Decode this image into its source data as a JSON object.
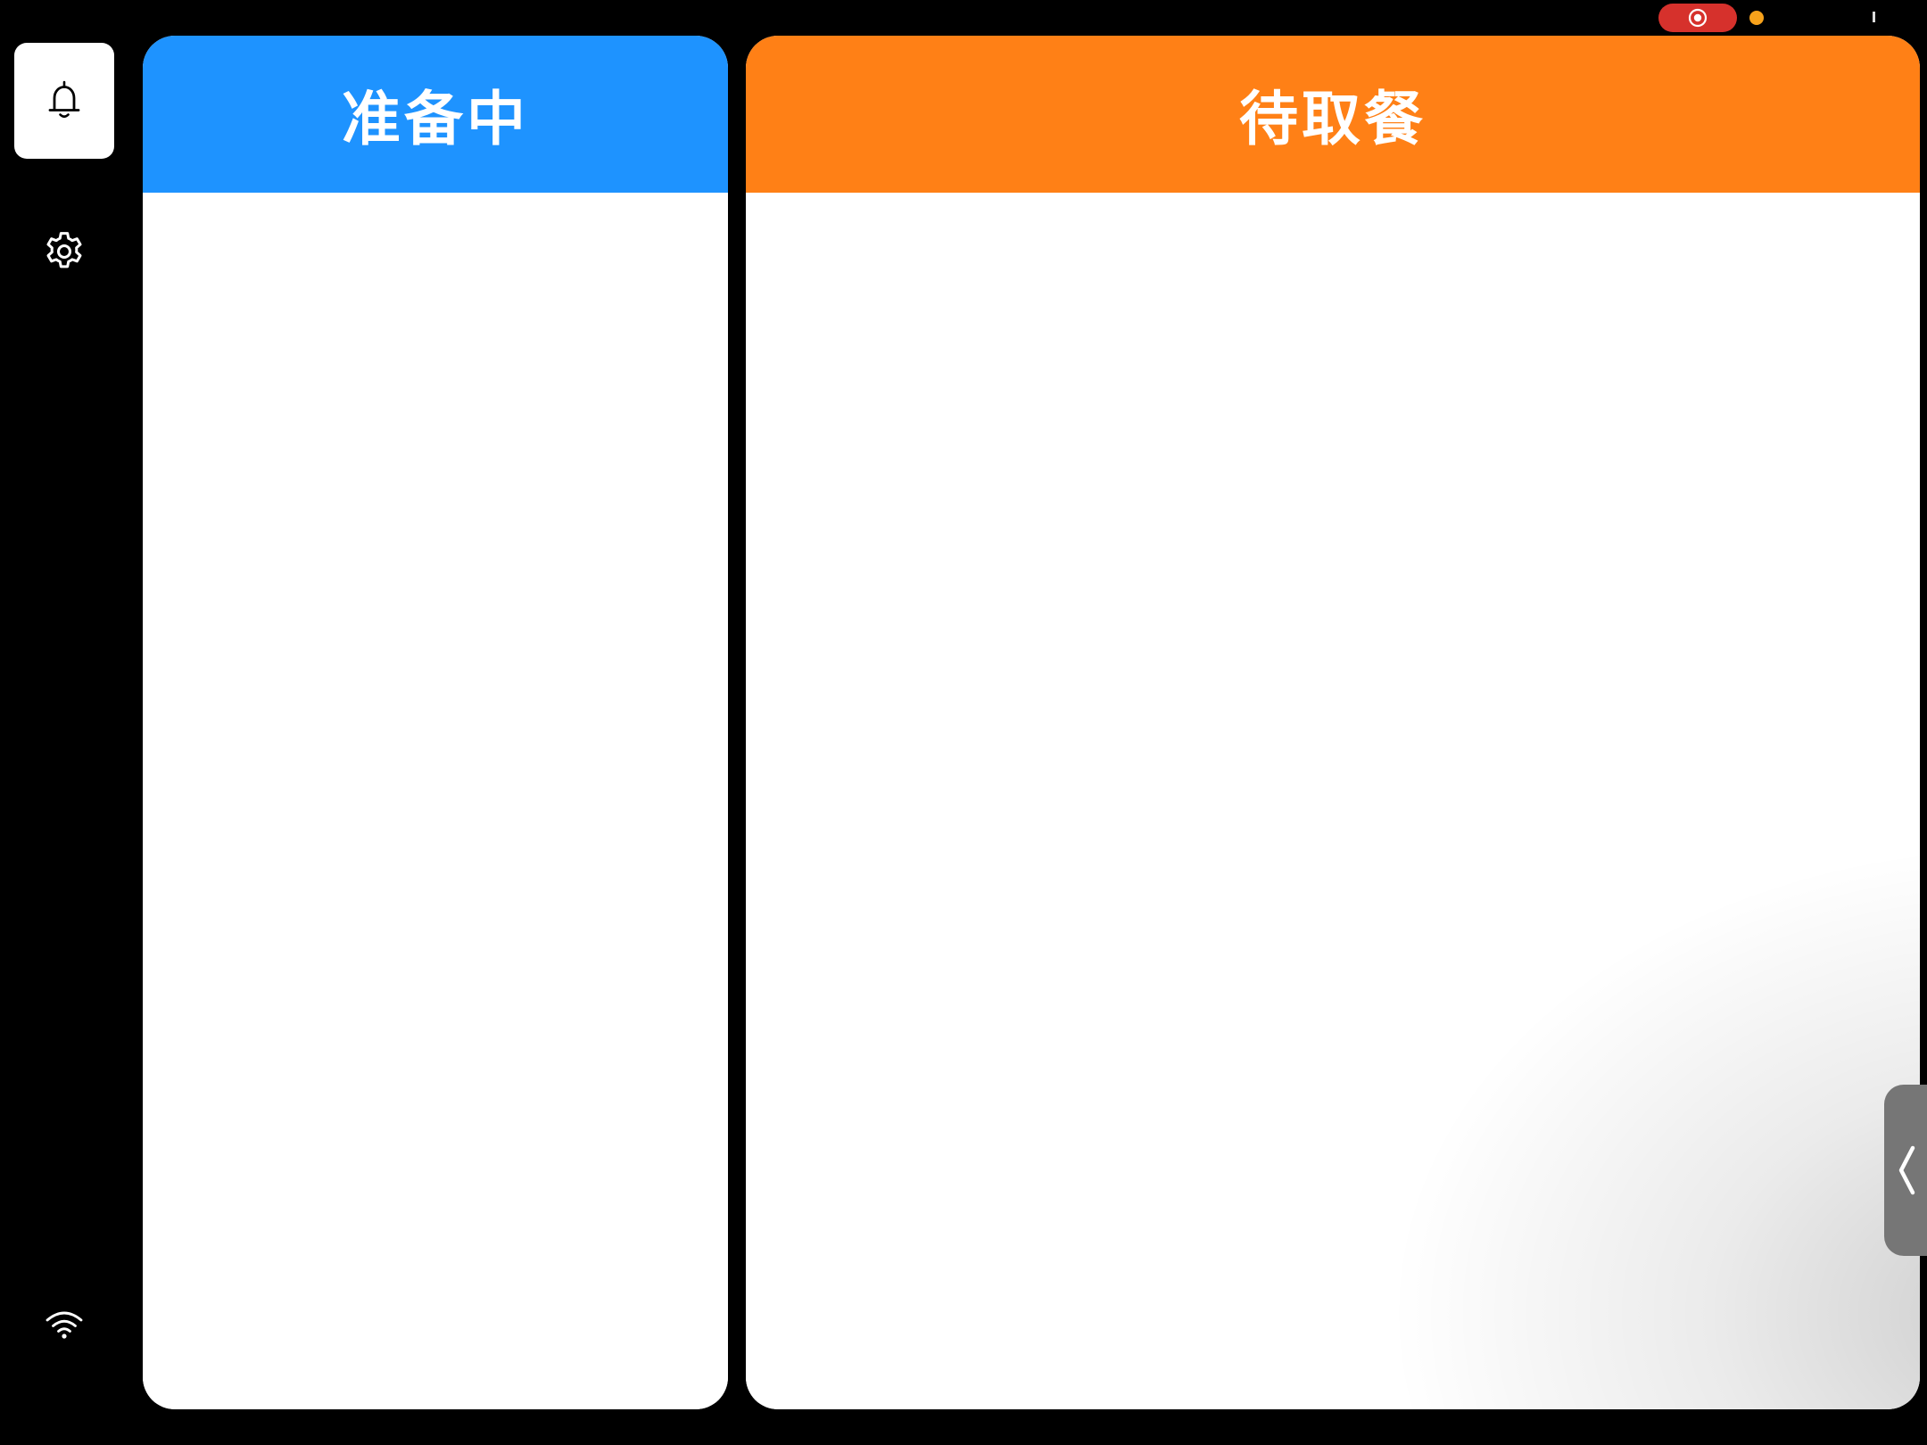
{
  "colors": {
    "preparing_header": "#1E93FF",
    "pickup_header": "#FF8016",
    "record_pill": "#D6312C",
    "status_dot": "#F7A21B",
    "drawer_handle": "#767676"
  },
  "status_bar": {
    "record_icon": "record-indicator-icon"
  },
  "sidebar": {
    "items": [
      {
        "id": "notifications",
        "icon": "bell-icon",
        "active": true
      },
      {
        "id": "settings",
        "icon": "gear-icon",
        "active": false
      }
    ],
    "connection_icon": "wifi-icon"
  },
  "panels": {
    "preparing": {
      "title": "准备中",
      "orders": []
    },
    "pickup": {
      "title": "待取餐",
      "orders": []
    }
  },
  "drawer": {
    "icon": "chevron-left-icon"
  }
}
